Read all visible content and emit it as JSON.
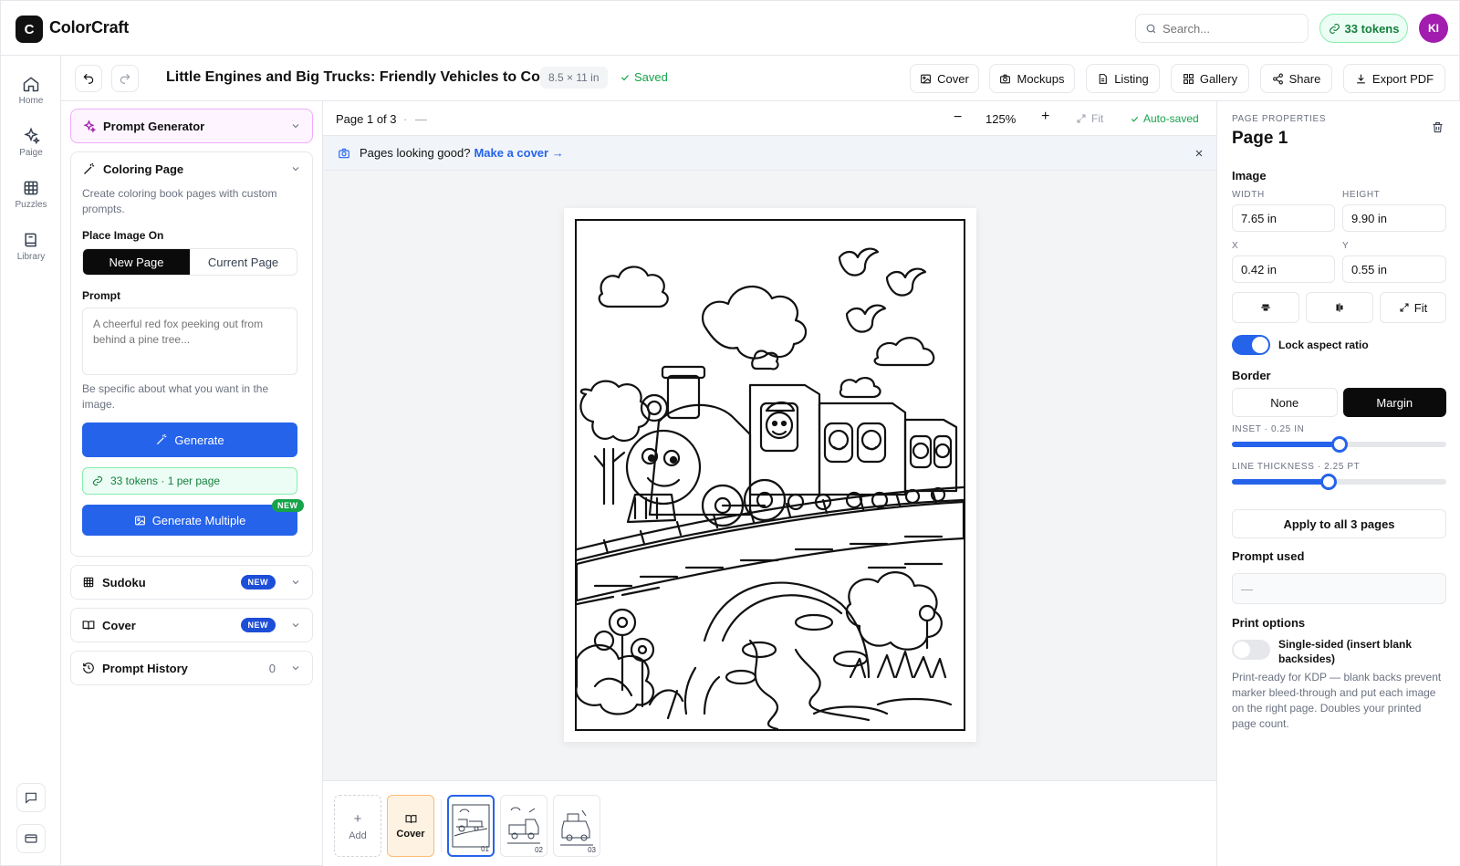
{
  "app": {
    "logo_letter": "C",
    "name": "ColorCraft",
    "search_placeholder": "Search...",
    "tokens": "33 tokens",
    "avatar": "KI"
  },
  "rail": {
    "items": [
      {
        "label": "Home",
        "icon": "home-icon"
      },
      {
        "label": "Paige",
        "icon": "sparkles-icon"
      },
      {
        "label": "Puzzles",
        "icon": "grid-icon"
      },
      {
        "label": "Library",
        "icon": "book-icon"
      }
    ]
  },
  "doc": {
    "title": "Little Engines and Big Trucks: Friendly Vehicles to Color",
    "size": "8.5 × 11 in",
    "status": "Saved",
    "actions": [
      "Cover",
      "Mockups",
      "Listing",
      "Gallery",
      "Share",
      "Export PDF"
    ]
  },
  "left": {
    "prompt_generator": "Prompt Generator",
    "coloring_page": {
      "title": "Coloring Page",
      "description": "Create coloring book pages with custom prompts.",
      "place_label": "Place Image On",
      "place_options": [
        "New Page",
        "Current Page"
      ],
      "prompt_label": "Prompt",
      "prompt_placeholder": "A cheerful red fox peeking out from behind a pine tree...",
      "hint": "Be specific about what you want in the image.",
      "generate": "Generate",
      "tokens_info": "33 tokens · 1 per page",
      "generate_multiple": "Generate Multiple",
      "new_badge": "NEW"
    },
    "sudoku": {
      "title": "Sudoku",
      "badge": "NEW"
    },
    "cover": {
      "title": "Cover",
      "badge": "NEW"
    },
    "history": {
      "title": "Prompt History",
      "count": "0"
    }
  },
  "canvas": {
    "page_indicator": "Page 1 of 3",
    "sep": "·",
    "dash": "—",
    "zoom_out": "−",
    "zoom": "125%",
    "zoom_in": "+",
    "fit": "Fit",
    "autosave": "Auto-saved",
    "banner_text": "Pages looking good?",
    "banner_link": "Make a cover →",
    "strip": {
      "add": "Add",
      "cover": "Cover",
      "pages": [
        "01",
        "02",
        "03"
      ]
    }
  },
  "right": {
    "caption": "PAGE PROPERTIES",
    "page_title": "Page 1",
    "image_label": "Image",
    "width_label": "WIDTH",
    "width": "7.65 in",
    "height_label": "HEIGHT",
    "height": "9.90 in",
    "x_label": "X",
    "x": "0.42 in",
    "y_label": "Y",
    "y": "0.55 in",
    "fit": "Fit",
    "lock_aspect": "Lock aspect ratio",
    "border_label": "Border",
    "border_options": [
      "None",
      "Margin"
    ],
    "inset_label": "INSET · 0.25 IN",
    "inset_fraction": 0.5,
    "thickness_label": "LINE THICKNESS · 2.25 PT",
    "thickness_fraction": 0.45,
    "apply_all": "Apply to all 3 pages",
    "prompt_used_label": "Prompt used",
    "prompt_used": "—",
    "print_options_label": "Print options",
    "single_sided": "Single-sided (insert blank backsides)",
    "print_note": "Print-ready for KDP — blank backs prevent marker bleed-through and put each image on the right page. Doubles your printed page count."
  },
  "colors": {
    "accent": "#2563eb",
    "success": "#16a34a",
    "dark": "#0b0b0b"
  }
}
